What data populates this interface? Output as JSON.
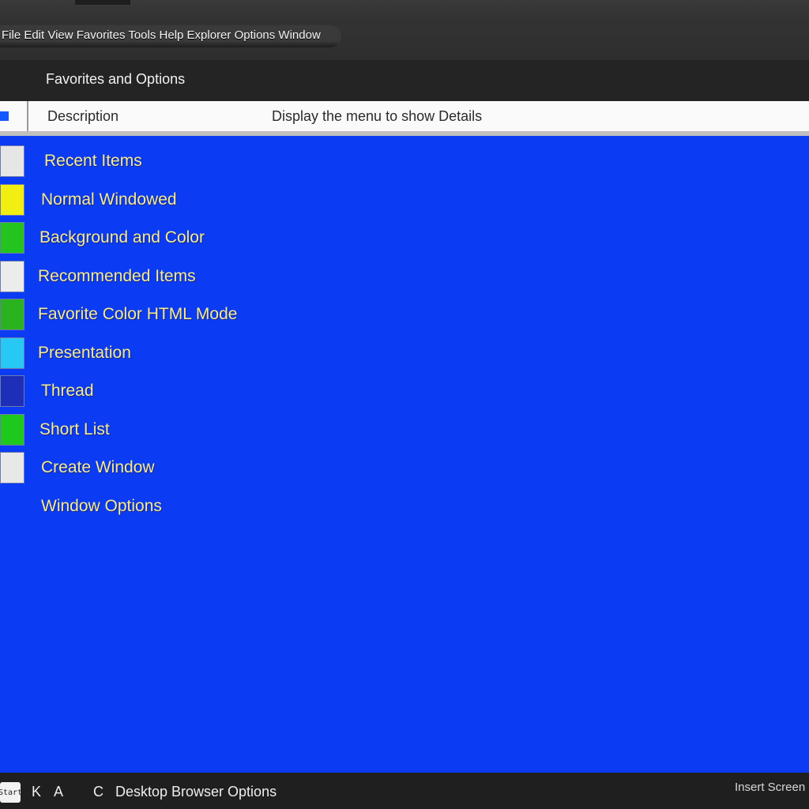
{
  "window": {
    "title": "File Edit View Favorites Tools Help Explorer Options Window"
  },
  "subheader": {
    "text": "Favorites and Options"
  },
  "columns": {
    "left": "Description",
    "right": "Display the menu to show Details"
  },
  "list": {
    "items": [
      {
        "label": "Recent Items",
        "swatch": "#e6e6e6",
        "indent": 56
      },
      {
        "label": "Normal Windowed",
        "swatch": "#f2ee12",
        "indent": 52
      },
      {
        "label": "Background and Color",
        "swatch": "#23c41d",
        "indent": 50
      },
      {
        "label": "Recommended Items",
        "swatch": "#ececec",
        "indent": 48
      },
      {
        "label": "Favorite Color HTML Mode",
        "swatch": "#2bb21f",
        "indent": 48
      },
      {
        "label": "Presentation",
        "swatch": "#27c9f4",
        "indent": 48
      },
      {
        "label": "Thread",
        "swatch": "#1d2fb8",
        "indent": 52
      },
      {
        "label": "Short List",
        "swatch": "#1fc81d",
        "indent": 50
      },
      {
        "label": "Create Window",
        "swatch": "#e8e8e8",
        "indent": 52
      },
      {
        "label": "Window Options",
        "swatch": "",
        "indent": 52
      }
    ]
  },
  "taskbar": {
    "start_label": "Start",
    "items": [
      "K",
      "A",
      "C"
    ],
    "status": "Desktop Browser Options",
    "right": "Insert Screen"
  },
  "colors": {
    "main_blue": "#0b3bf2",
    "label_yellow": "#f2ea9a",
    "header_dark": "#262626"
  }
}
